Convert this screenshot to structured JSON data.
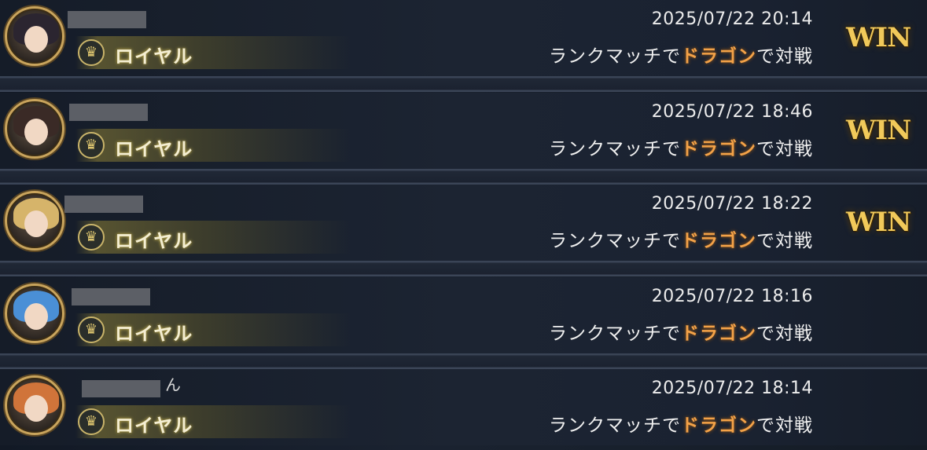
{
  "matches": [
    {
      "name_suffix": "",
      "class": "ロイヤル",
      "date": "2025/07/22 20:14",
      "mode_prefix": "ランクマッチで",
      "opponent": "ドラゴン",
      "mode_suffix": "で対戦",
      "result": "WIN",
      "hair_color": "#2b2530"
    },
    {
      "name_suffix": "",
      "class": "ロイヤル",
      "date": "2025/07/22 18:46",
      "mode_prefix": "ランクマッチで",
      "opponent": "ドラゴン",
      "mode_suffix": "で対戦",
      "result": "WIN",
      "hair_color": "#3a2a26"
    },
    {
      "name_suffix": "",
      "class": "ロイヤル",
      "date": "2025/07/22 18:22",
      "mode_prefix": "ランクマッチで",
      "opponent": "ドラゴン",
      "mode_suffix": "で対戦",
      "result": "WIN",
      "hair_color": "#d6b46a"
    },
    {
      "name_suffix": "",
      "class": "ロイヤル",
      "date": "2025/07/22 18:16",
      "mode_prefix": "ランクマッチで",
      "opponent": "ドラゴン",
      "mode_suffix": "で対戦",
      "result": "",
      "hair_color": "#4a8fd6"
    },
    {
      "name_suffix": "ん",
      "class": "ロイヤル",
      "date": "2025/07/22 18:14",
      "mode_prefix": "ランクマッチで",
      "opponent": "ドラゴン",
      "mode_suffix": "で対戦",
      "result": "",
      "hair_color": "#d0743a"
    }
  ],
  "icons": {
    "class_icon": "crown-icon"
  }
}
